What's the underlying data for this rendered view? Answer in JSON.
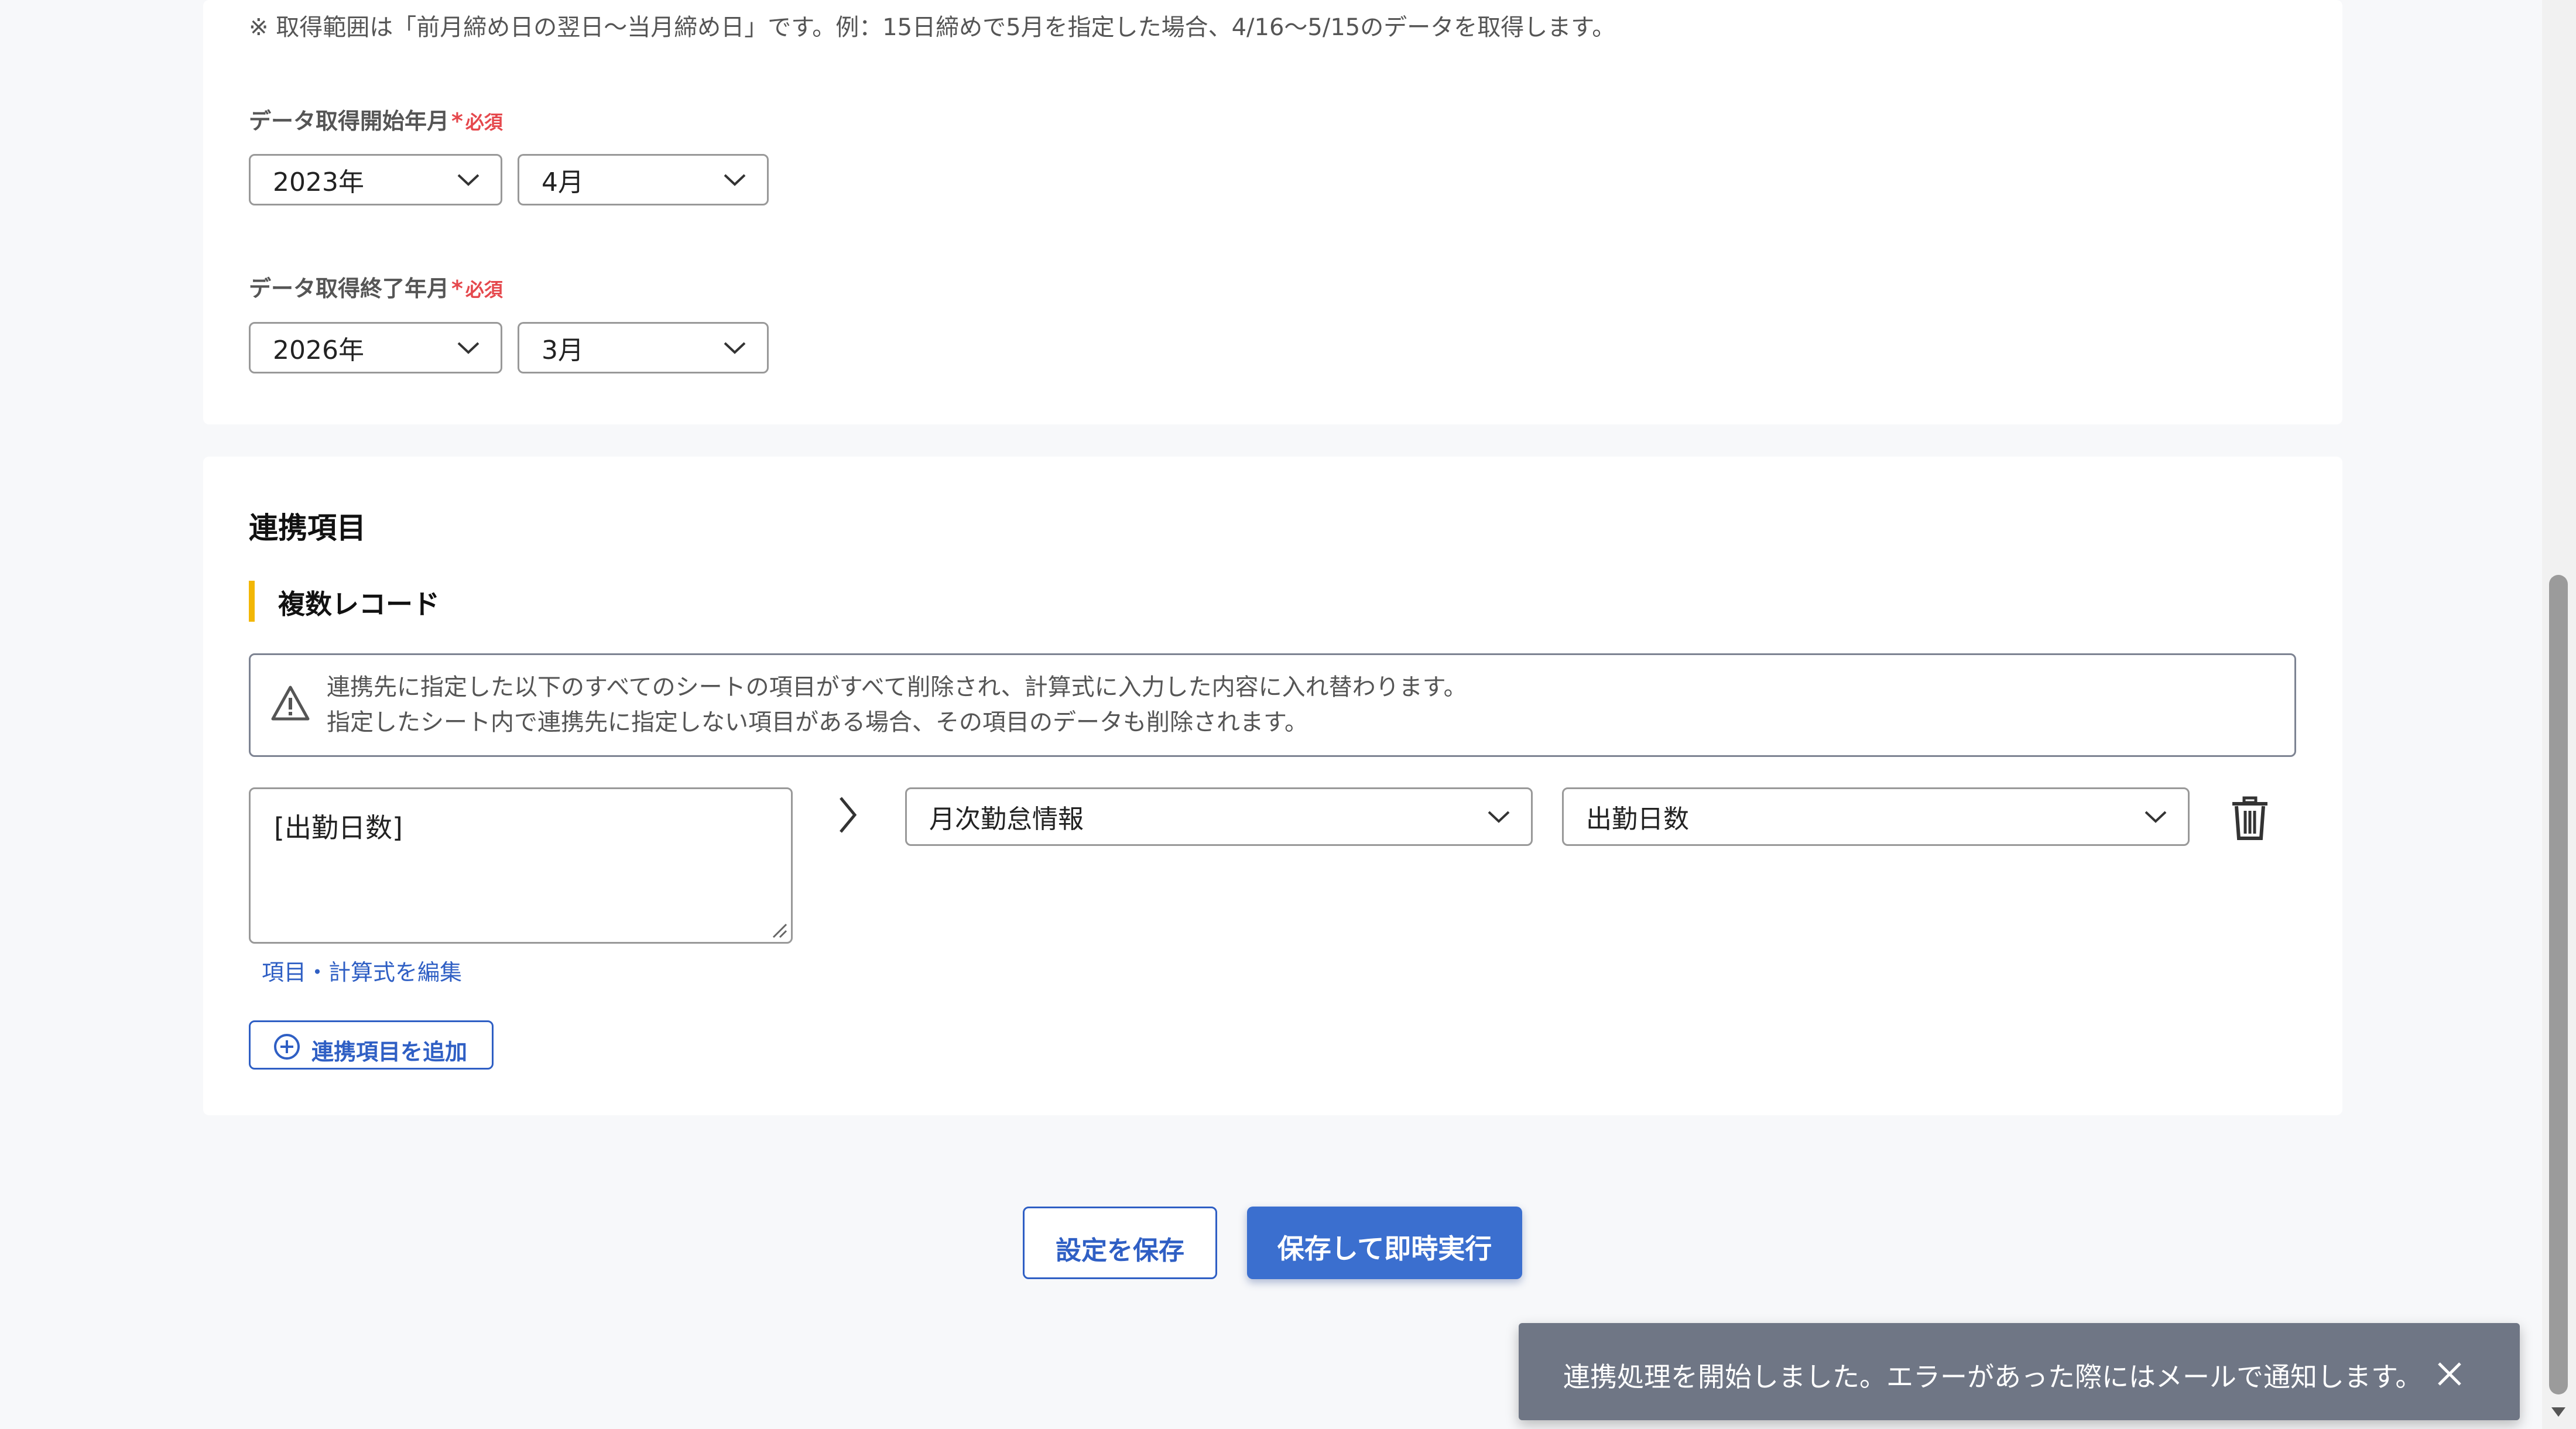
{
  "range_note": "※ 取得範囲は「前月締め日の翌日〜当月締め日」です。例：15日締めで5月を指定した場合、4/16〜5/15のデータを取得します。",
  "required_star": "*",
  "required_text": "必須",
  "start": {
    "label": "データ取得開始年月",
    "year": "2023年",
    "month": "4月"
  },
  "end": {
    "label": "データ取得終了年月",
    "year": "2026年",
    "month": "3月"
  },
  "items_section": {
    "title": "連携項目",
    "subsection": "複数レコード",
    "warning": {
      "line1": "連携先に指定した以下のすべてのシートの項目がすべて削除され、計算式に入力した内容に入れ替わります。",
      "line2": "指定したシート内で連携先に指定しない項目がある場合、その項目のデータも削除されます。"
    },
    "mapping": {
      "formula": "[出勤日数]",
      "sheet": "月次勤怠情報",
      "field": "出勤日数"
    },
    "edit_link": "項目・計算式を編集",
    "add_button": "連携項目を追加"
  },
  "footer": {
    "save": "設定を保存",
    "save_run": "保存して即時実行"
  },
  "toast": {
    "message": "連携処理を開始しました。エラーがあった際にはメールで通知します。"
  },
  "colors": {
    "primary": "#3b6fcf",
    "link": "#2f5fc4",
    "required": "#e5484d",
    "accent": "#f2b705",
    "toast": "#6f7685"
  },
  "icons": {
    "chevron": "chevron-down-icon",
    "warning": "warning-triangle-icon",
    "arrow": "chevron-right-icon",
    "trash": "trash-icon",
    "add": "plus-circle-icon",
    "close": "close-icon"
  }
}
